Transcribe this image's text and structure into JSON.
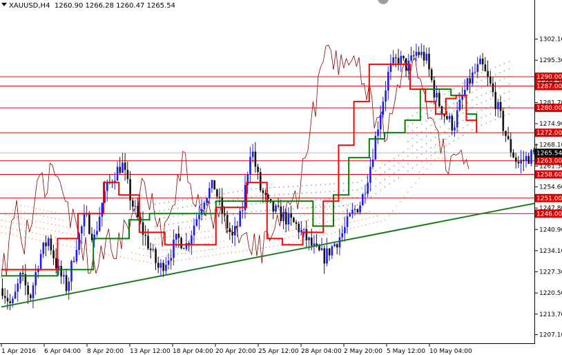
{
  "header": {
    "symbol": "XAUUSD,H4",
    "ohlc": "1260.90 1266.28 1260.47 1265.54"
  },
  "colors": {
    "bull": "#1a1aff",
    "bear": "#111111",
    "tenkan": "#ff0000",
    "kijun": "#008000",
    "chikou": "#8b0000",
    "kumo_up": "#2e8b57",
    "kumo_down": "#ff4500",
    "level_line": "#e00000",
    "trendline": "#1e7a1e",
    "price_tag": "#e00000",
    "current_tag": "#000000"
  },
  "chart_data": {
    "type": "candlestick",
    "title": "XAUUSD,H4",
    "ylim": [
      1205.0,
      1308.0
    ],
    "y_ticks": [
      "1302.10",
      "1295.30",
      "1288.50",
      "1281.70",
      "1274.90",
      "1268.10",
      "1261.30",
      "1254.60",
      "1247.80",
      "1240.90",
      "1234.10",
      "1227.30",
      "1220.50",
      "1213.70",
      "1207.10"
    ],
    "x_ticks": [
      "1 Apr 2016",
      "6 Apr 04:00",
      "8 Apr 20:00",
      "13 Apr 12:00",
      "18 Apr 04:00",
      "20 Apr 20:00",
      "25 Apr 12:00",
      "28 Apr 04:00",
      "2 May 20:00",
      "5 May 12:00",
      "10 May 04:00"
    ],
    "horizontal_levels": [
      "1290.00",
      "1287.00",
      "1280.00",
      "1272.00",
      "1263.00",
      "1258.60",
      "1251.00",
      "1246.00"
    ],
    "current_price": "1265.54",
    "trendline": {
      "from": [
        0,
        1216.0
      ],
      "to": [
        210,
        1249.5
      ]
    },
    "candle_path": [
      1222,
      1216,
      1226,
      1219,
      1232,
      1238,
      1228,
      1222,
      1236,
      1245,
      1238,
      1252,
      1258,
      1262,
      1250,
      1242,
      1235,
      1228,
      1232,
      1238,
      1236,
      1244,
      1252,
      1255,
      1245,
      1238,
      1246,
      1268,
      1254,
      1248,
      1246,
      1244,
      1242,
      1238,
      1234,
      1232,
      1236,
      1240,
      1246,
      1250,
      1262,
      1278,
      1292,
      1296,
      1293,
      1298,
      1296,
      1284,
      1278,
      1274,
      1284,
      1290,
      1294,
      1287,
      1278,
      1268,
      1262,
      1264,
      1265.5
    ],
    "tenkan": [
      [
        0,
        1228
      ],
      [
        14,
        1228
      ],
      [
        22,
        1238
      ],
      [
        30,
        1246
      ],
      [
        40,
        1256
      ],
      [
        46,
        1252
      ],
      [
        54,
        1240
      ],
      [
        64,
        1236
      ],
      [
        72,
        1236
      ],
      [
        84,
        1248
      ],
      [
        96,
        1256
      ],
      [
        102,
        1256
      ],
      [
        104,
        1238
      ],
      [
        110,
        1236
      ],
      [
        118,
        1240
      ],
      [
        126,
        1250
      ],
      [
        132,
        1268
      ],
      [
        138,
        1282
      ],
      [
        144,
        1294
      ],
      [
        150,
        1294
      ],
      [
        160,
        1286
      ],
      [
        166,
        1282
      ],
      [
        170,
        1278
      ],
      [
        174,
        1283
      ],
      [
        178,
        1284
      ],
      [
        182,
        1276
      ],
      [
        186,
        1272
      ]
    ],
    "kijun": [
      [
        0,
        1226
      ],
      [
        22,
        1228
      ],
      [
        36,
        1238
      ],
      [
        50,
        1244
      ],
      [
        58,
        1246
      ],
      [
        72,
        1246
      ],
      [
        84,
        1250
      ],
      [
        104,
        1250
      ],
      [
        122,
        1242
      ],
      [
        130,
        1252
      ],
      [
        136,
        1264
      ],
      [
        144,
        1270
      ],
      [
        150,
        1272
      ],
      [
        158,
        1276
      ],
      [
        164,
        1286
      ],
      [
        170,
        1286
      ],
      [
        176,
        1284
      ],
      [
        182,
        1278
      ],
      [
        186,
        1276
      ]
    ],
    "kumo_green": [
      [
        60,
        1242
      ],
      [
        100,
        1247
      ],
      [
        140,
        1249
      ],
      [
        170,
        1266
      ],
      [
        186,
        1274
      ],
      [
        210,
        1282
      ]
    ],
    "kumo_red": [
      [
        0,
        1240
      ],
      [
        60,
        1230
      ],
      [
        110,
        1236
      ],
      [
        150,
        1244
      ],
      [
        170,
        1264
      ]
    ]
  }
}
